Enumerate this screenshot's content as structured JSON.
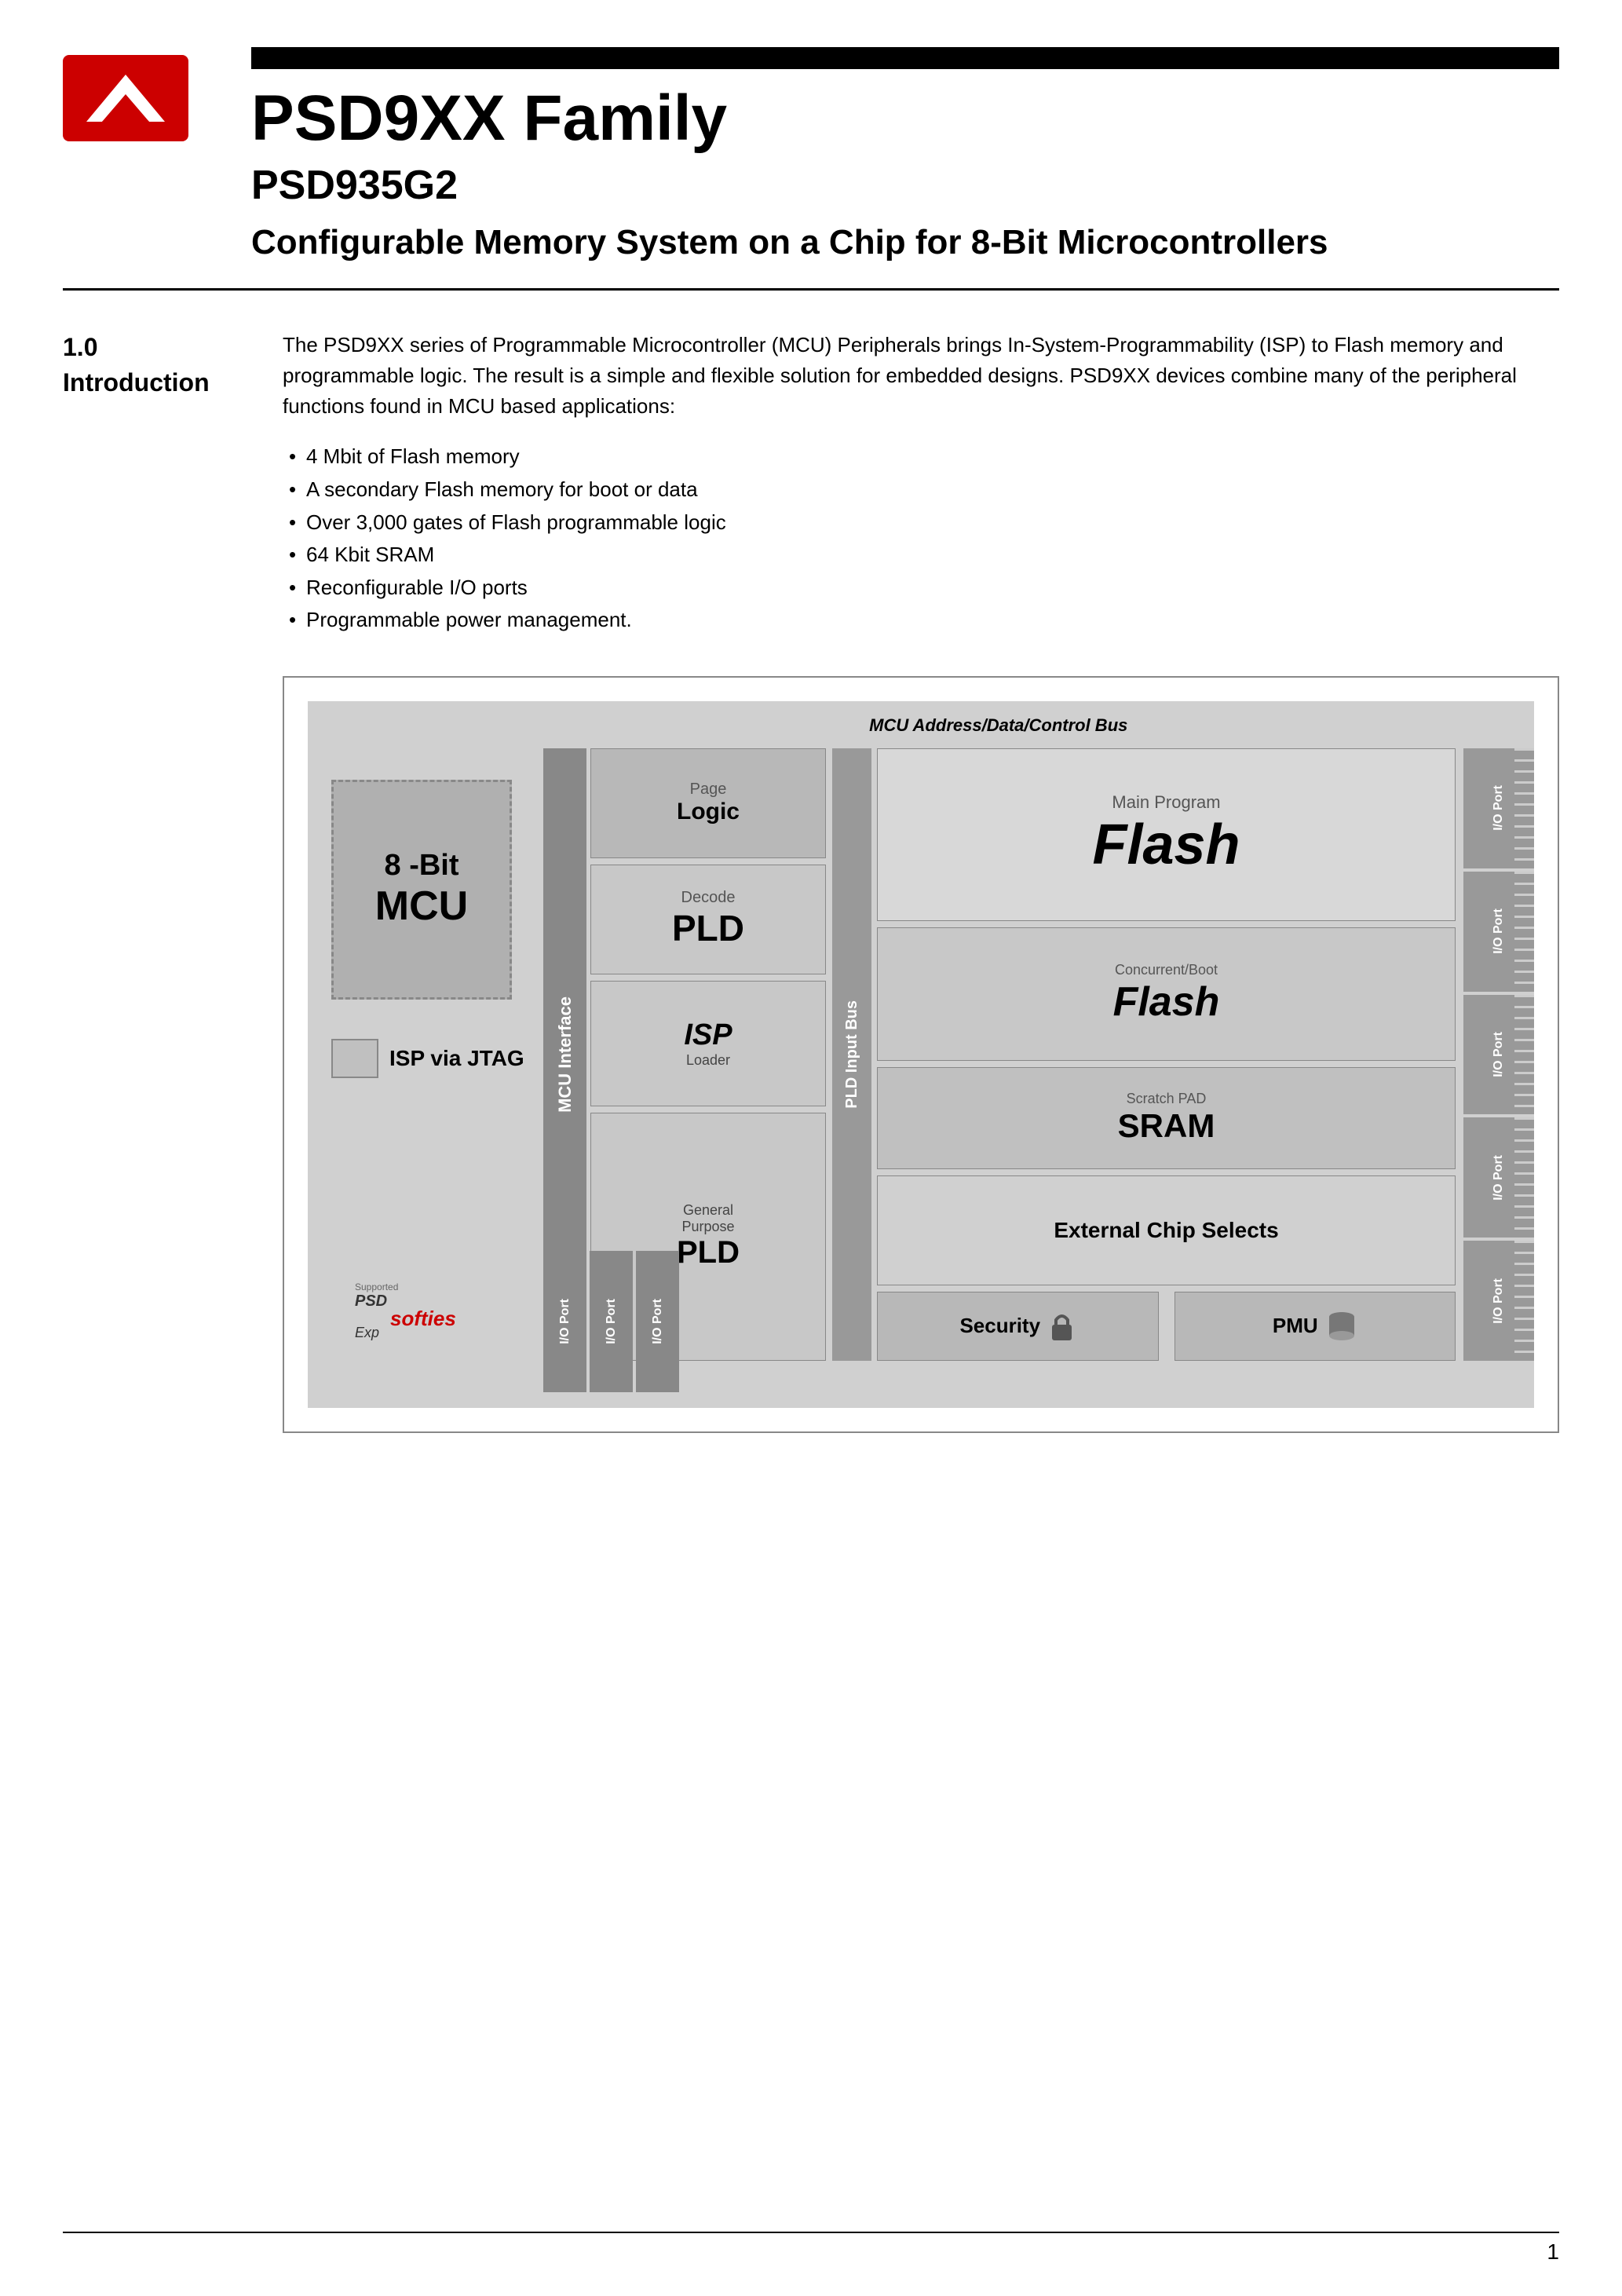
{
  "header": {
    "black_bar": "",
    "main_title": "PSD9XX Family",
    "sub_title": "PSD935G2",
    "desc_title": "Configurable Memory System on a Chip for 8-Bit Microcontrollers"
  },
  "section": {
    "number": "1.0",
    "name": "Introduction"
  },
  "intro": {
    "paragraph": "The PSD9XX series of Programmable Microcontroller (MCU) Peripherals brings In-System-Programmability (ISP) to Flash memory and programmable logic. The result is a simple and flexible solution for embedded designs. PSD9XX devices combine many of the peripheral functions found in MCU based applications:"
  },
  "bullets": [
    "4 Mbit of Flash memory",
    "A secondary Flash memory for boot or data",
    "Over 3,000 gates of Flash programmable logic",
    "64 Kbit SRAM",
    "Reconfigurable I/O ports",
    "Programmable power management."
  ],
  "diagram": {
    "bus_label": "MCU Address/Data/Control Bus",
    "mcu_label_top": "8 -Bit",
    "mcu_label_bottom": "MCU",
    "mcu_interface": "MCU Interface",
    "isp_via_jtag": "ISP via JTAG",
    "page_logic_small": "Page",
    "page_logic_big": "Logic",
    "decode_small": "Decode",
    "decode_pld": "PLD",
    "isp_italic": "ISP",
    "loader": "Loader",
    "gen_purpose_top": "General",
    "gen_purpose_mid": "Purpose",
    "gen_purpose_pld": "PLD",
    "pld_input_bus": "PLD Input Bus",
    "main_program": "Main Program",
    "flash_big": "Flash",
    "concurrent_boot": "Concurrent/Boot",
    "boot_flash": "Flash",
    "scratch_pad": "Scratch PAD",
    "sram": "SRAM",
    "ext_chip": "External Chip Selects",
    "security": "Security",
    "pmu": "PMU",
    "io_port": "I/O Port"
  },
  "page_number": "1"
}
